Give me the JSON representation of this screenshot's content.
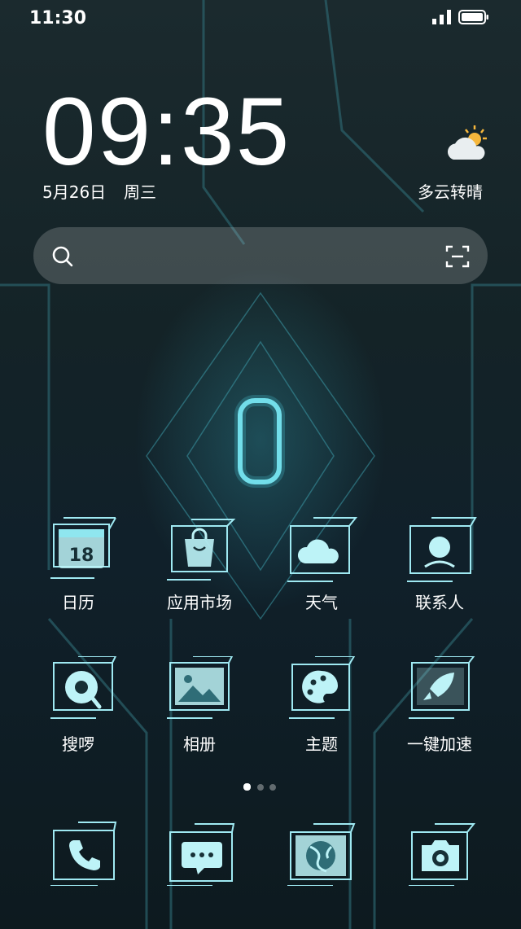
{
  "status_bar": {
    "time": "11:30"
  },
  "lock_clock": {
    "time": "09:35",
    "date": "5月26日",
    "weekday": "周三"
  },
  "weather": {
    "icon": "partly-cloudy-icon",
    "text": "多云转晴"
  },
  "search": {
    "icon": "search-icon",
    "scan_icon": "scan-icon"
  },
  "apps_row1": [
    {
      "label": "日历",
      "icon": "calendar-icon",
      "badge": "18"
    },
    {
      "label": "应用市场",
      "icon": "shopping-bag-icon"
    },
    {
      "label": "天气",
      "icon": "cloud-icon"
    },
    {
      "label": "联系人",
      "icon": "contact-person-icon"
    }
  ],
  "apps_row2": [
    {
      "label": "搜啰",
      "icon": "search-bubble-icon"
    },
    {
      "label": "相册",
      "icon": "photo-mountain-icon"
    },
    {
      "label": "主题",
      "icon": "palette-icon"
    },
    {
      "label": "一键加速",
      "icon": "rocket-icon"
    }
  ],
  "page_indicator": {
    "count": 3,
    "active": 1
  },
  "dock": [
    {
      "icon": "phone-icon"
    },
    {
      "icon": "message-icon"
    },
    {
      "icon": "browser-icon"
    },
    {
      "icon": "camera-icon"
    }
  ],
  "colors": {
    "accent": "#8fe6ef",
    "icon_fill": "#bdf3f7",
    "frame": "#9fe9f2"
  }
}
